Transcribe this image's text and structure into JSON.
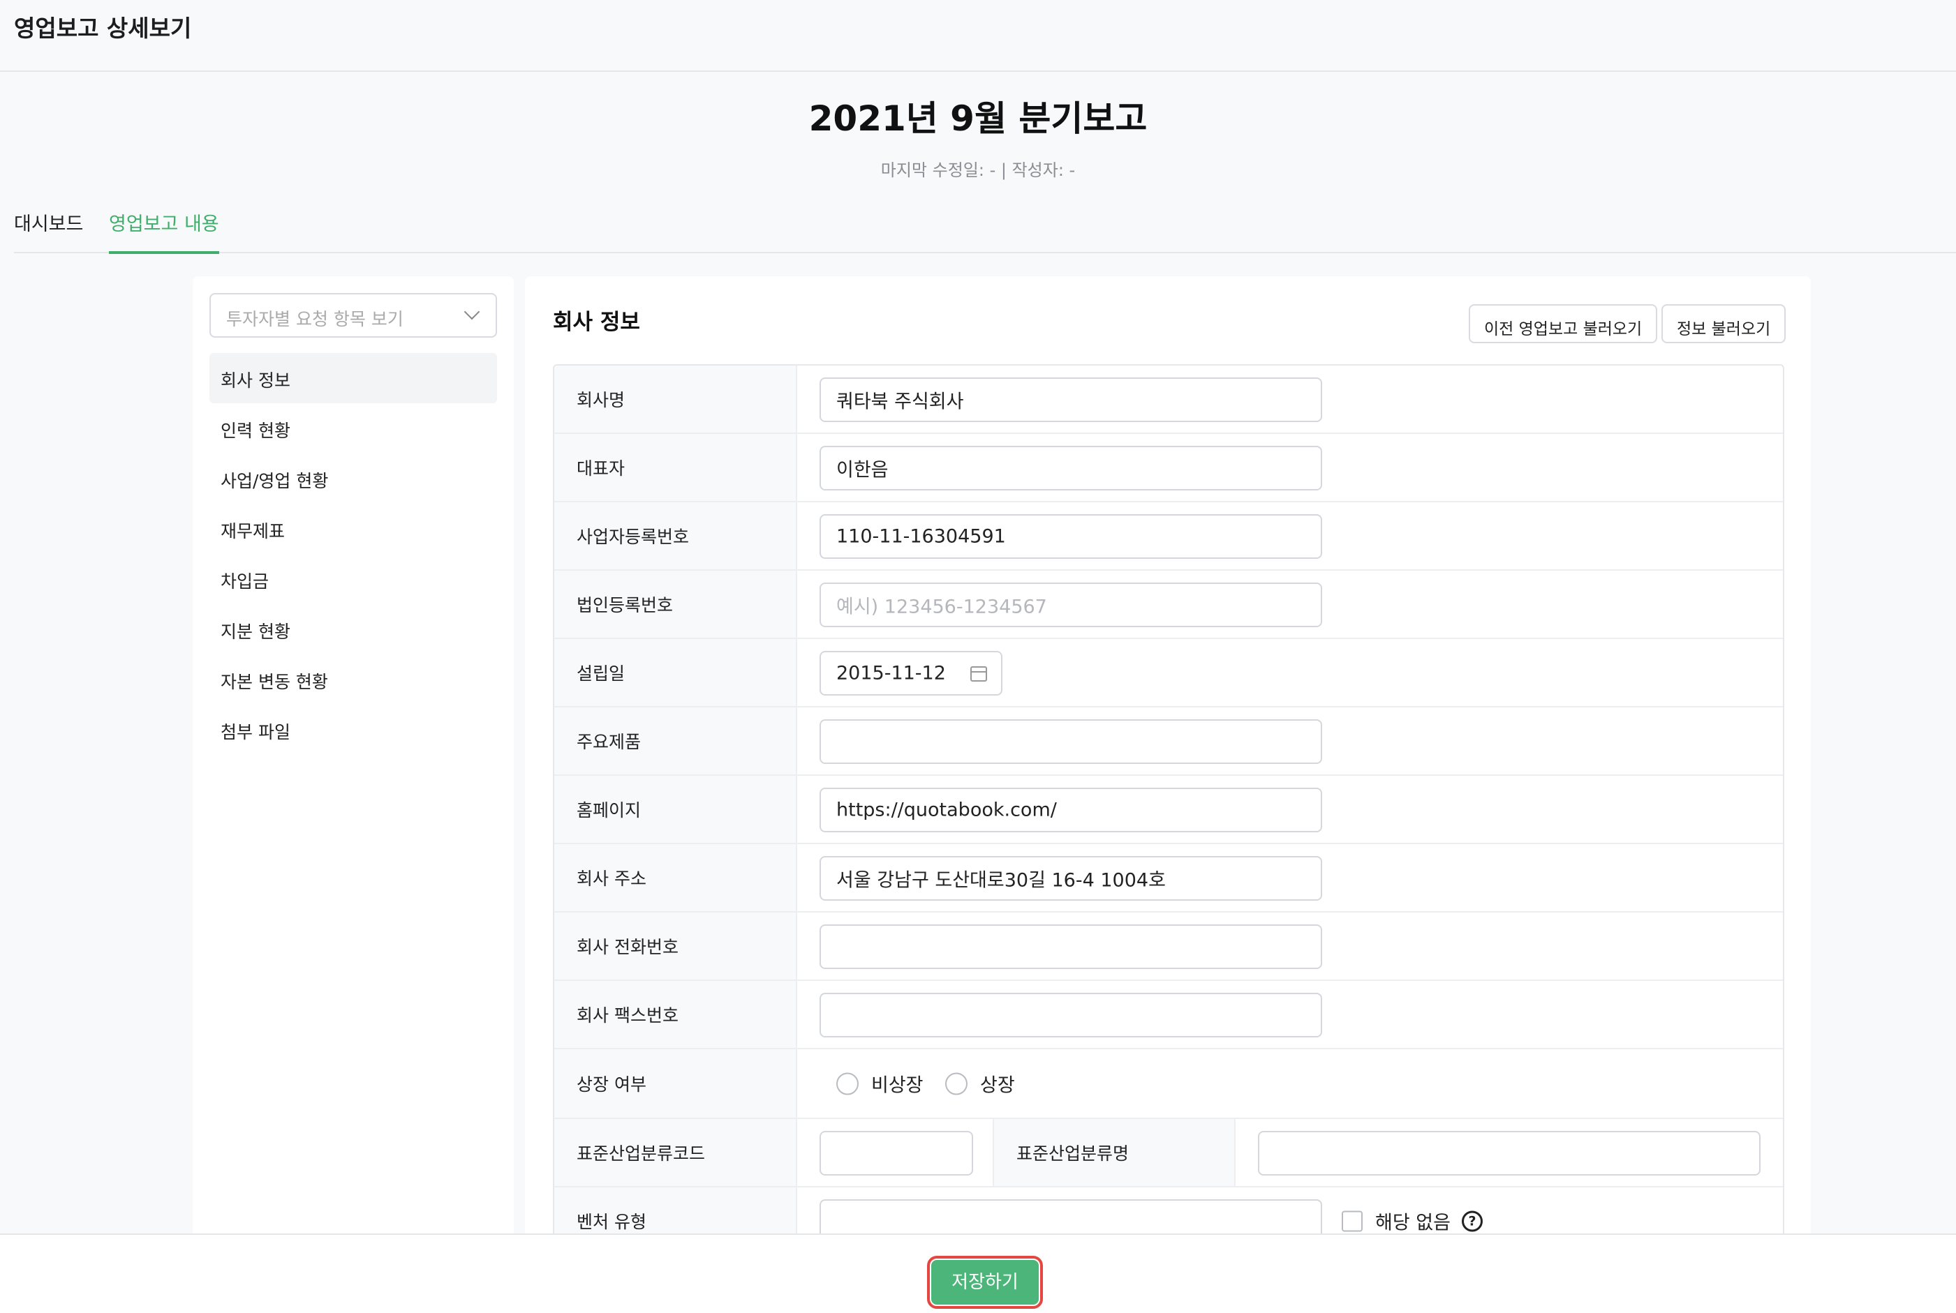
{
  "window": {
    "title": "영업보고 상세보기"
  },
  "report": {
    "title": "2021년 9월 분기보고",
    "meta": "마지막 수정일: - | 작성자: -"
  },
  "tabs": [
    {
      "label": "대시보드",
      "active": false
    },
    {
      "label": "영업보고 내용",
      "active": true
    }
  ],
  "sidebar": {
    "select_placeholder": "투자자별 요청 항목 보기",
    "items": [
      {
        "label": "회사 정보",
        "active": true
      },
      {
        "label": "인력 현황"
      },
      {
        "label": "사업/영업 현황"
      },
      {
        "label": "재무제표"
      },
      {
        "label": "차입금"
      },
      {
        "label": "지분 현황"
      },
      {
        "label": "자본 변동 현황"
      },
      {
        "label": "첨부 파일"
      }
    ]
  },
  "panel": {
    "title": "회사 정보",
    "load_prev_label": "이전 영업보고 불러오기",
    "load_info_label": "정보 불러오기"
  },
  "form": {
    "company_name": {
      "label": "회사명",
      "value": "쿼타북 주식회사"
    },
    "ceo": {
      "label": "대표자",
      "value": "이한음"
    },
    "biz_reg_no": {
      "label": "사업자등록번호",
      "value": "110-11-16304591"
    },
    "corp_reg_no": {
      "label": "법인등록번호",
      "value": "",
      "placeholder": "예시) 123456-1234567"
    },
    "founded": {
      "label": "설립일",
      "value": "2015-11-12"
    },
    "main_products": {
      "label": "주요제품",
      "value": ""
    },
    "homepage": {
      "label": "홈페이지",
      "value": "https://quotabook.com/"
    },
    "address": {
      "label": "회사 주소",
      "value": "서울 강남구 도산대로30길 16-4 1004호"
    },
    "phone": {
      "label": "회사 전화번호",
      "value": ""
    },
    "fax": {
      "label": "회사 팩스번호",
      "value": ""
    },
    "listing": {
      "label": "상장 여부",
      "options": [
        "비상장",
        "상장"
      ]
    },
    "ind_code": {
      "label": "표준산업분류코드",
      "value": ""
    },
    "ind_name": {
      "label": "표준산업분류명",
      "value": ""
    },
    "venture": {
      "label": "벤처 유형",
      "value": "",
      "none_label": "해당 없음"
    }
  },
  "footer": {
    "save_label": "저장하기"
  },
  "colors": {
    "accent": "#3fae6a",
    "save_button": "#4cb57a",
    "highlight": "#e4473f"
  }
}
